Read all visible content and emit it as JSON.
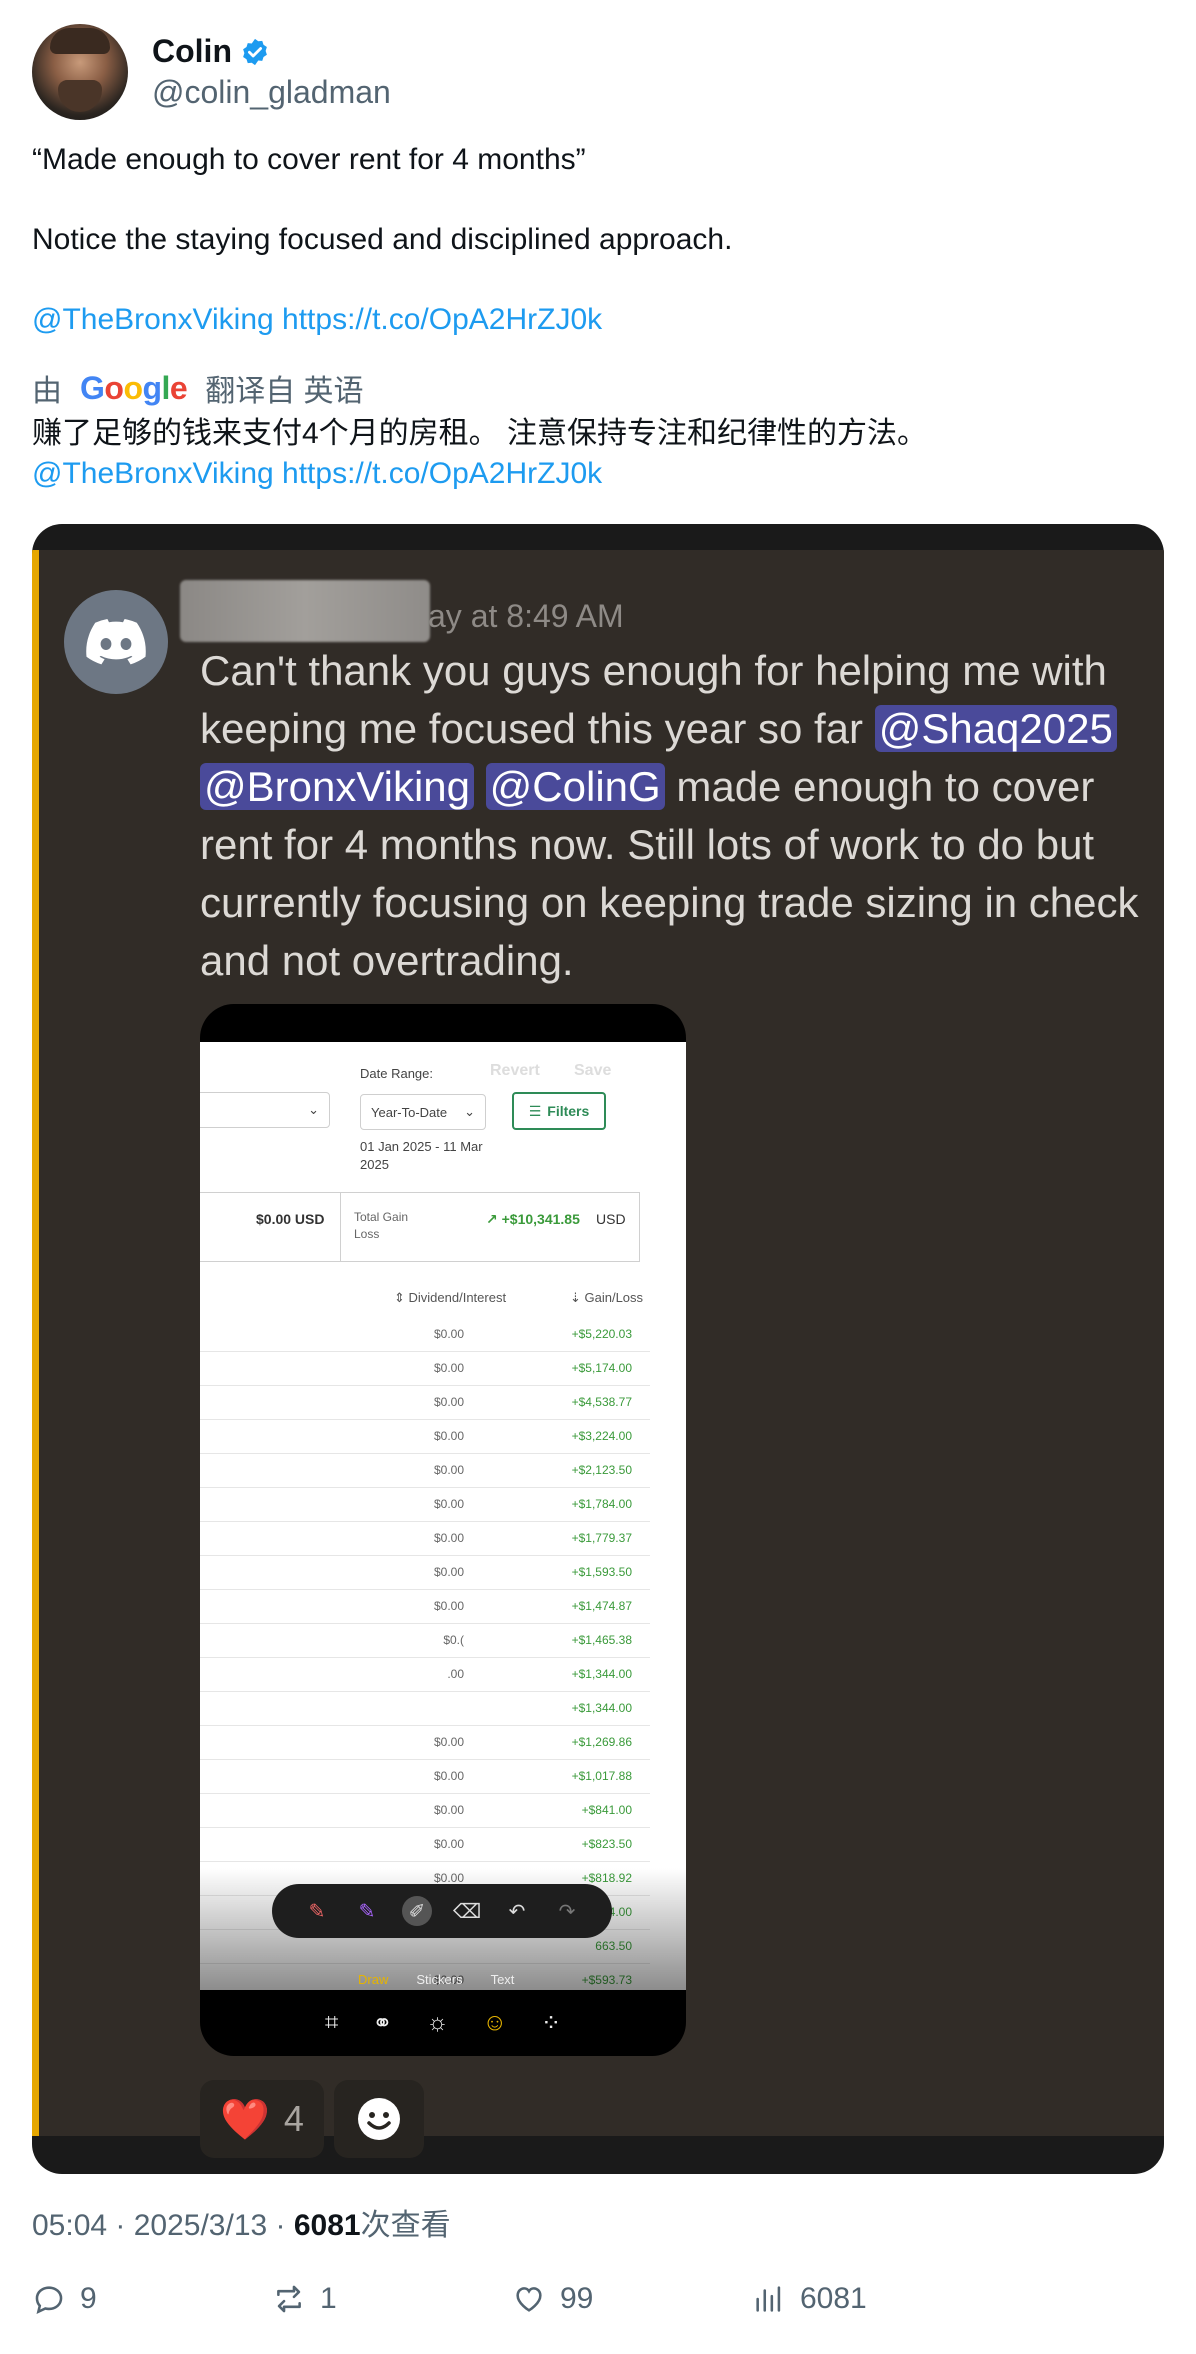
{
  "author": {
    "name": "Colin",
    "handle": "@colin_gladman"
  },
  "tweet": {
    "line1": "“Made enough to cover rent for 4 months”",
    "line2": "Notice the staying focused and disciplined approach.",
    "mention": "@TheBronxViking",
    "link": "https://t.co/OpA2HrZJ0k"
  },
  "translation": {
    "prefix": "由",
    "google": [
      "G",
      "o",
      "o",
      "g",
      "l",
      "e"
    ],
    "suffix": "翻译自 英语",
    "text": "赚了足够的钱来支付4个月的房租。 注意保持专注和纪律性的方法。",
    "mention": "@TheBronxViking",
    "link": "https://t.co/OpA2HrZJ0k"
  },
  "discord": {
    "timestamp": "ay at 8:49 AM",
    "message_pre": "Can't thank you guys enough for helping me with keeping me focused this year so far ",
    "mention1": "@Shaq2025",
    "mention2": "@BronxViking",
    "mention3": "@ColinG",
    "message_post": " made enough to cover rent for 4 months now. Still lots of work to do but currently focusing on keeping trade sizing in check and not overtrading.",
    "reaction_count": "4",
    "heart_emoji": "❤️"
  },
  "screenshot": {
    "date_range_label": "Date Range:",
    "date_range_value": "Year-To-Date",
    "date_range_text": "01 Jan 2025 - 11 Mar 2025",
    "revert": "Revert",
    "save": "Save",
    "filters": "Filters",
    "summary_left": "$0.00 USD",
    "summary_label": "Total Gain Loss",
    "summary_value": "↗ +$10,341.85",
    "summary_currency": "USD",
    "col_dividend": "⇕ Dividend/Interest",
    "col_gain": "⇣ Gain/Loss",
    "rows": [
      {
        "div": "$0.00",
        "gain": "+$5,220.03"
      },
      {
        "div": "$0.00",
        "gain": "+$5,174.00"
      },
      {
        "div": "$0.00",
        "gain": "+$4,538.77"
      },
      {
        "div": "$0.00",
        "gain": "+$3,224.00"
      },
      {
        "div": "$0.00",
        "gain": "+$2,123.50"
      },
      {
        "div": "$0.00",
        "gain": "+$1,784.00"
      },
      {
        "div": "$0.00",
        "gain": "+$1,779.37"
      },
      {
        "div": "$0.00",
        "gain": "+$1,593.50"
      },
      {
        "div": "$0.00",
        "gain": "+$1,474.87"
      },
      {
        "div": "$0.(",
        "gain": "+$1,465.38"
      },
      {
        "div": ".00",
        "gain": "+$1,344.00"
      },
      {
        "div": "",
        "gain": "+$1,344.00"
      },
      {
        "div": "$0.00",
        "gain": "+$1,269.86"
      },
      {
        "div": "$0.00",
        "gain": "+$1,017.88"
      },
      {
        "div": "$0.00",
        "gain": "+$841.00"
      },
      {
        "div": "$0.00",
        "gain": "+$823.50"
      },
      {
        "div": "$0.00",
        "gain": "+$818.92"
      },
      {
        "div": "",
        "gain": "4.00"
      },
      {
        "div": "",
        "gain": "663.50"
      },
      {
        "div": "$0.00",
        "gain": "+$593.73"
      }
    ],
    "tab_draw": "Draw",
    "tab_stickers": "Stickers",
    "tab_text": "Text"
  },
  "meta": {
    "time": "05:04 · 2025/3/13 · ",
    "views": "6081",
    "views_label": "次查看"
  },
  "actions": {
    "replies": "9",
    "reposts": "1",
    "likes": "99",
    "views": "6081"
  },
  "colors": {
    "link": "#1d9bf0",
    "muted": "#536471",
    "discord_bg": "#312c27",
    "mention_bg": "#4a4a9a",
    "gain_green": "#3a9a3a"
  }
}
